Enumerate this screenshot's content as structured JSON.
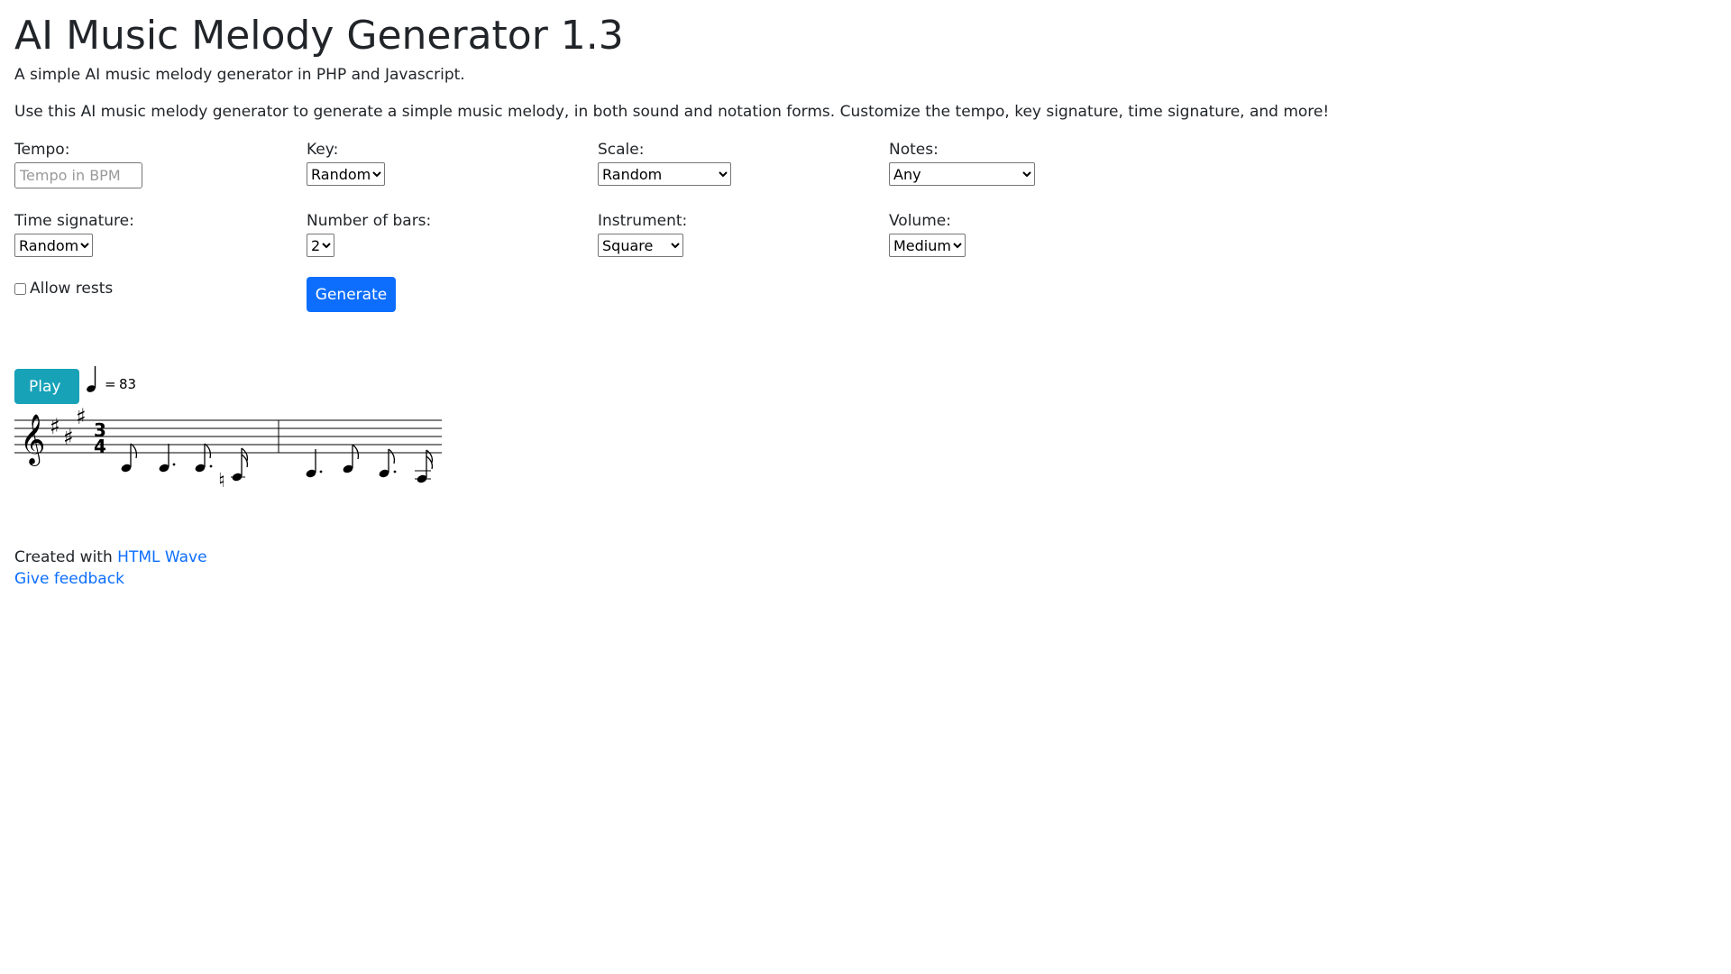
{
  "header": {
    "title": "AI Music Melody Generator 1.3",
    "subtitle": "A simple AI music melody generator in PHP and Javascript.",
    "intro": "Use this AI music melody generator to generate a simple music melody, in both sound and notation forms. Customize the tempo, key signature, time signature, and more!"
  },
  "form": {
    "tempo": {
      "label": "Tempo:",
      "placeholder": "Tempo in BPM"
    },
    "key": {
      "label": "Key:",
      "value": "Random"
    },
    "scale": {
      "label": "Scale:",
      "value": "Random"
    },
    "notes": {
      "label": "Notes:",
      "value": "Any"
    },
    "time_signature": {
      "label": "Time signature:",
      "value": "Random"
    },
    "bars": {
      "label": "Number of bars:",
      "value": "2"
    },
    "instrument": {
      "label": "Instrument:",
      "value": "Square"
    },
    "volume": {
      "label": "Volume:",
      "value": "Medium"
    },
    "allow_rests": {
      "label": "Allow rests",
      "checked": false
    },
    "generate_label": "Generate"
  },
  "player": {
    "play_label": "Play",
    "tempo_equals": "=",
    "tempo_value": "83"
  },
  "notation": {
    "clef": "treble",
    "key_signature": "sharps",
    "sharps_count": 2,
    "time_signature": {
      "top": "3",
      "bottom": "4"
    }
  },
  "footer": {
    "created_prefix": "Created with",
    "created_link": "HTML Wave",
    "feedback_link": "Give feedback"
  }
}
